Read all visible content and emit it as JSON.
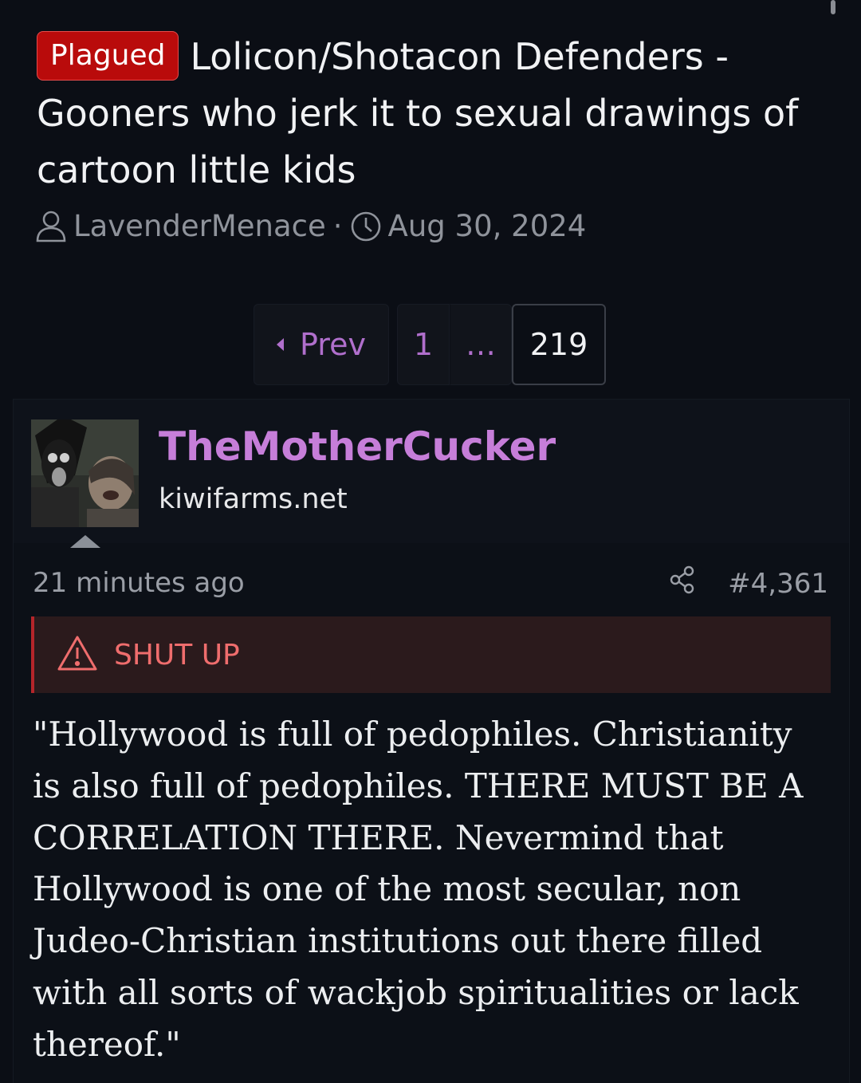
{
  "thread": {
    "prefix": "Plagued",
    "title": "Lolicon/Shotacon Defenders - Gooners who jerk it to sexual drawings of cartoon little kids",
    "author": "LavenderMenace",
    "meta_separator": "·",
    "date": "Aug 30, 2024"
  },
  "pagination": {
    "prev_label": "Prev",
    "first_page": "1",
    "ellipsis": "…",
    "current_page": "219"
  },
  "post": {
    "username": "TheMotherCucker",
    "user_title": "kiwifarms.net",
    "time_ago": "21 minutes ago",
    "post_number": "#4,361",
    "spoiler_label": "SHUT UP",
    "body": "\"Hollywood is full of pedophiles. Christianity is also full of pedophiles. THERE MUST BE A CORRELATION THERE. Nevermind that Hollywood is one of the most secular, non Judeo-Christian institutions out there filled with all sorts of wackjob spiritualities or lack thereof.\""
  },
  "icons": {
    "author": "user-icon",
    "date": "clock-icon",
    "share": "share-icon",
    "warning": "warning-icon",
    "prev": "chevron-left-icon",
    "expand": "caret-up-icon"
  },
  "colors": {
    "background": "#0b0e15",
    "prefix_badge": "#b90b0b",
    "accent": "#b06fcc",
    "username": "#c67ed9",
    "spoiler_bg": "#2b1a1c",
    "spoiler_border": "#b5252a",
    "spoiler_text": "#ef6d6d"
  }
}
